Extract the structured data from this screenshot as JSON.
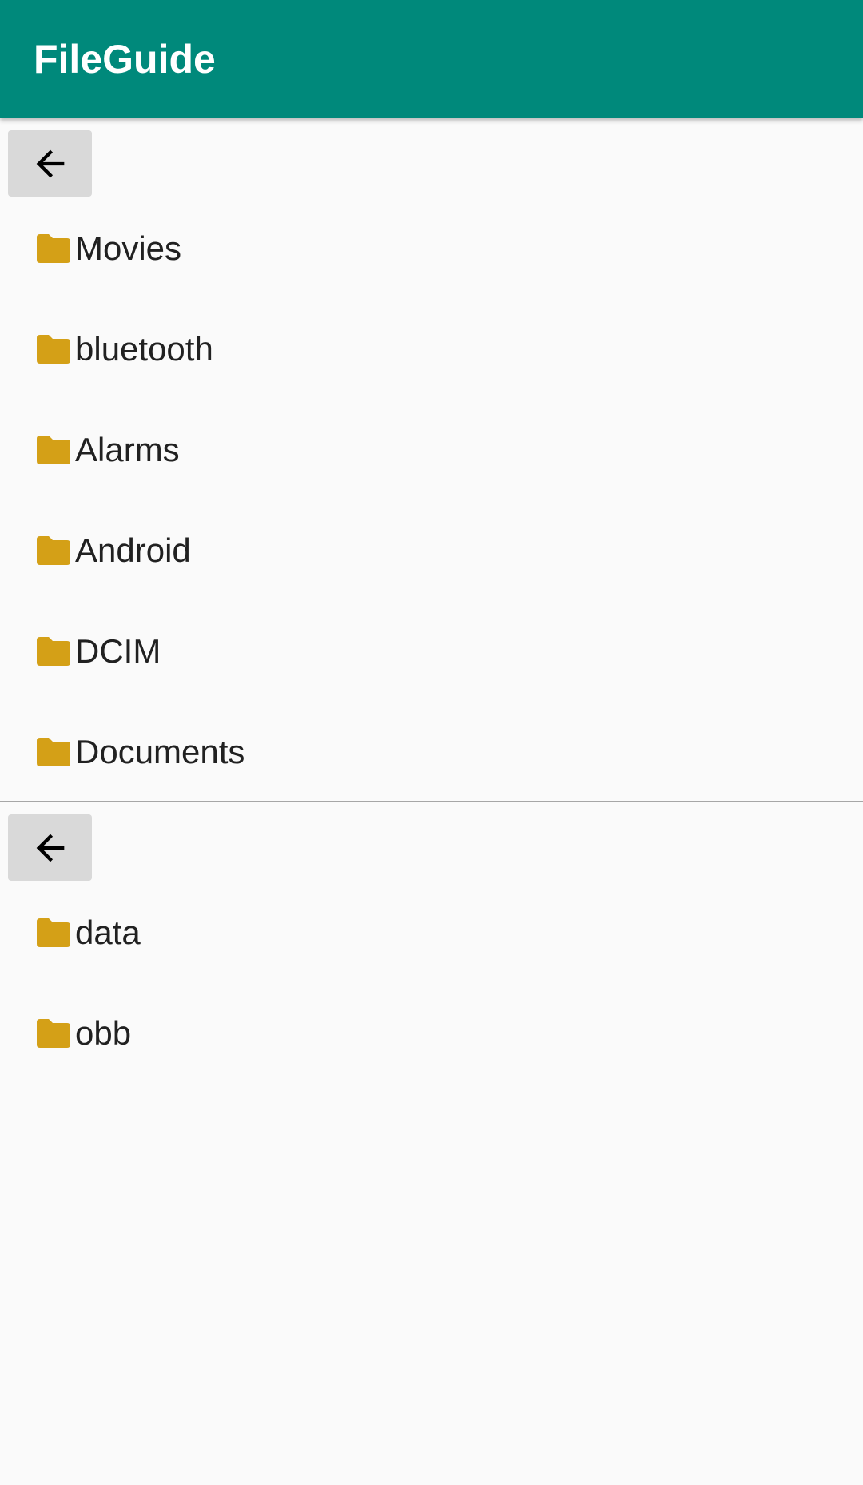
{
  "app": {
    "title": "FileGuide"
  },
  "colors": {
    "app_bar": "#00897b",
    "folder_icon": "#d4a017",
    "background": "#fafafa",
    "back_button_bg": "#d9d9d9"
  },
  "icons": {
    "back": "arrow-left-icon",
    "folder": "folder-icon"
  },
  "top_pane": {
    "folders": [
      {
        "name": "Movies"
      },
      {
        "name": "bluetooth"
      },
      {
        "name": "Alarms"
      },
      {
        "name": "Android"
      },
      {
        "name": "DCIM"
      },
      {
        "name": "Documents"
      }
    ]
  },
  "bottom_pane": {
    "folders": [
      {
        "name": "data"
      },
      {
        "name": "obb"
      }
    ]
  }
}
